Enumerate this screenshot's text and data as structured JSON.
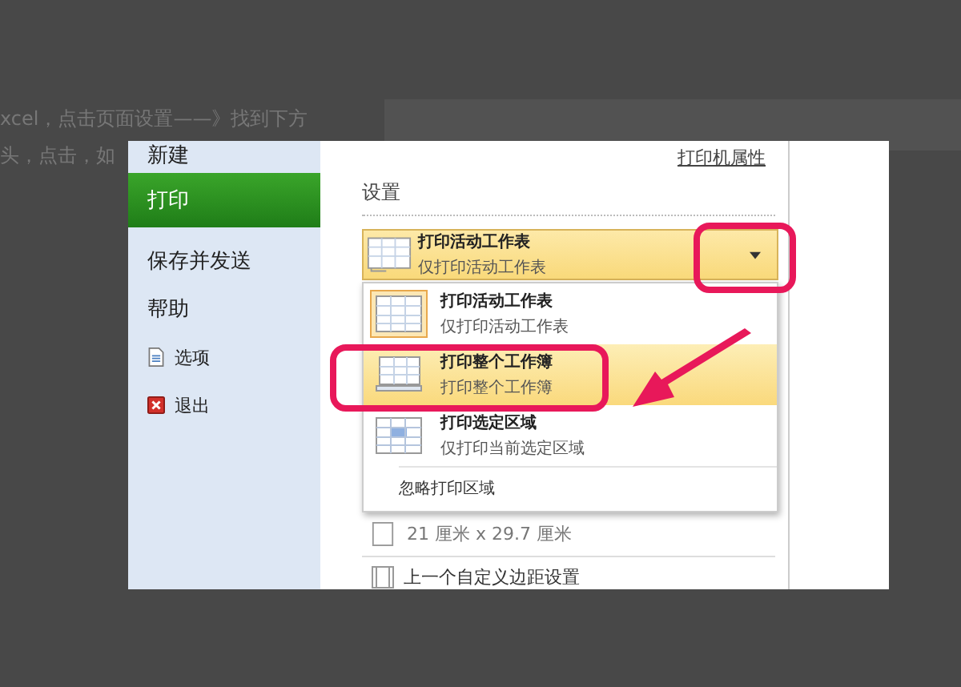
{
  "background_text": [
    "xcel，点击页面设置——》找到下方",
    "头，点击，如"
  ],
  "sidebar": {
    "items": [
      {
        "label": "新建",
        "selected": false,
        "kind": "plain"
      },
      {
        "label": "打印",
        "selected": true,
        "kind": "plain"
      },
      {
        "label": "保存并发送",
        "selected": false,
        "kind": "plain"
      },
      {
        "label": "帮助",
        "selected": false,
        "kind": "plain"
      },
      {
        "label": "选项",
        "selected": false,
        "kind": "options"
      },
      {
        "label": "退出",
        "selected": false,
        "kind": "exit"
      }
    ]
  },
  "print_settings": {
    "printer_properties_link": "打印机属性",
    "heading": "设置",
    "dropdown": {
      "title": "打印活动工作表",
      "subtitle": "仅打印活动工作表"
    },
    "options": [
      {
        "title": "打印活动工作表",
        "subtitle": "仅打印活动工作表",
        "selected": false,
        "current": true,
        "kind": "sheet"
      },
      {
        "title": "打印整个工作簿",
        "subtitle": "打印整个工作簿",
        "selected": true,
        "current": false,
        "kind": "workbook"
      },
      {
        "title": "打印选定区域",
        "subtitle": "仅打印当前选定区域",
        "selected": false,
        "current": false,
        "kind": "selection"
      }
    ],
    "ignore_print_area": "忽略打印区域",
    "paper_size": "21 厘米 x 29.7 厘米",
    "margins": "上一个自定义边距设置"
  }
}
